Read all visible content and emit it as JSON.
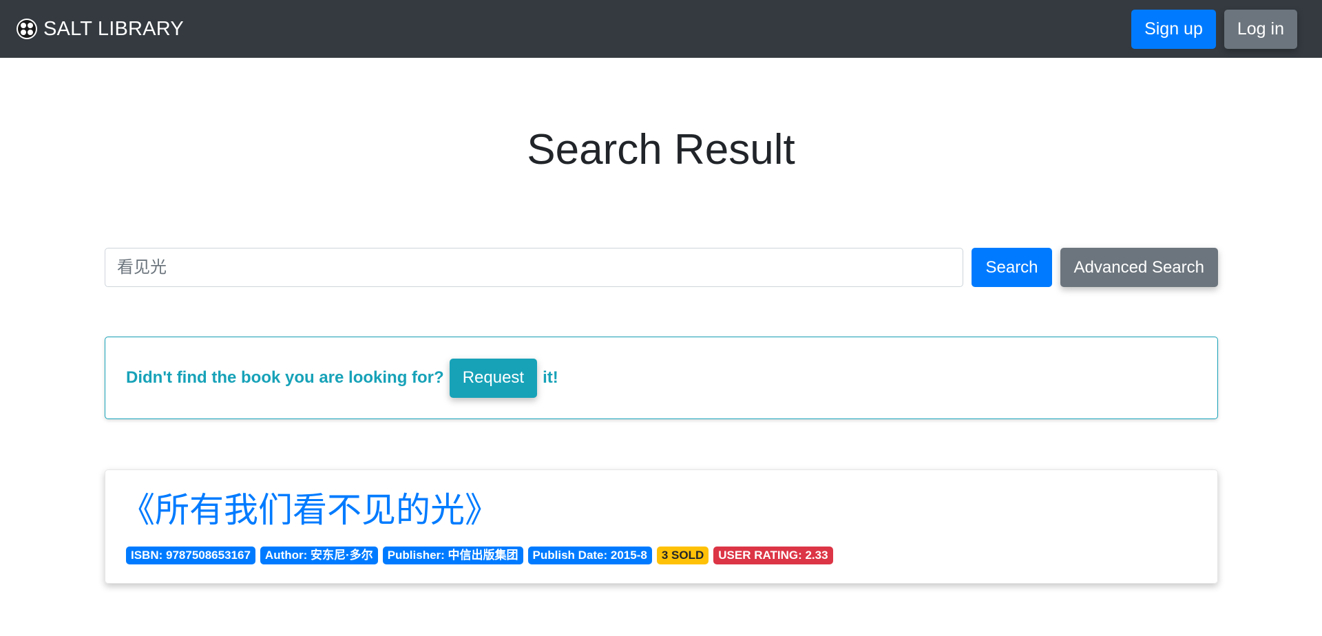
{
  "navbar": {
    "brand": "SALT LIBRARY",
    "signup_label": "Sign up",
    "login_label": "Log in"
  },
  "page_title": "Search Result",
  "search": {
    "value": "",
    "placeholder": "看见光",
    "search_label": "Search",
    "advanced_label": "Advanced Search"
  },
  "request_box": {
    "text_before": "Didn't find the book you are looking for?",
    "button_label": "Request",
    "text_after": "it!"
  },
  "results": [
    {
      "title": "《所有我们看不见的光》",
      "isbn": "ISBN: 9787508653167",
      "author": "Author: 安东尼·多尔",
      "publisher": "Publisher: 中信出版集团",
      "publish_date": "Publish Date: 2015-8",
      "sold": "3 SOLD",
      "rating": "USER RATING: 2.33"
    }
  ],
  "colors": {
    "navbar_bg": "#343a40",
    "primary": "#007bff",
    "secondary": "#6c757d",
    "info": "#17a2b8",
    "warning": "#ffc107",
    "danger": "#dc3545"
  }
}
